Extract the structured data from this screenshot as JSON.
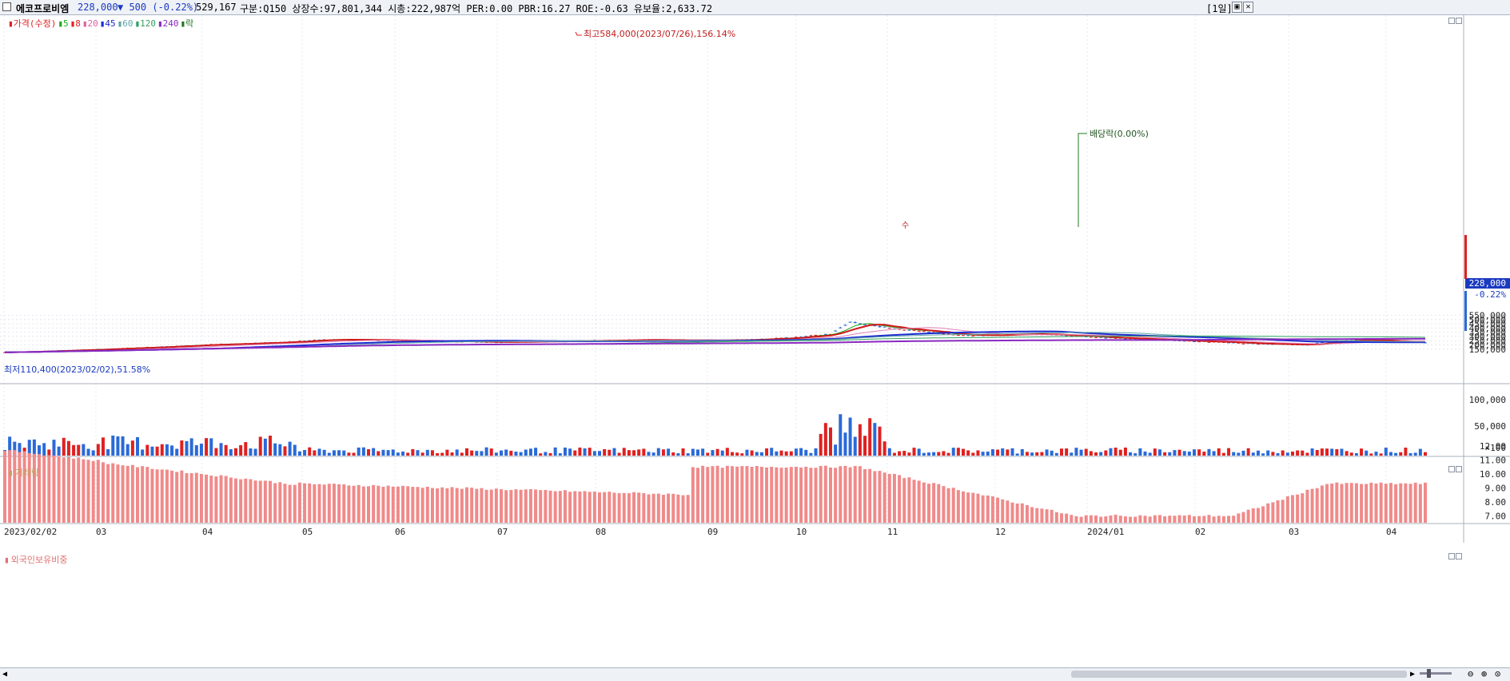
{
  "header": {
    "stock_name": "에코프로비엠",
    "price": "228,000",
    "change": "▼ 500 (-0.22%)",
    "volume": "529,167",
    "info": "구분:Q150 상장수:97,801,344 시총:222,987억 PER:0.00 PBR:16.27 ROE:-0.63 유보율:2,633.72",
    "period_button": "[1일]",
    "restore_icon": "restore-window-icon",
    "close_icon": "close-window-icon"
  },
  "price_panel": {
    "legend": [
      {
        "text": "가격(수정)",
        "color": "#e02020"
      },
      {
        "text": "5",
        "color": "#22aa22"
      },
      {
        "text": "8",
        "color": "#e02020"
      },
      {
        "text": "20",
        "color": "#e060a0"
      },
      {
        "text": "45",
        "color": "#1a2ad0"
      },
      {
        "text": "60",
        "color": "#60a8a8"
      },
      {
        "text": "120",
        "color": "#30a060"
      },
      {
        "text": "240",
        "color": "#8a2ac0"
      },
      {
        "text": "락",
        "color": "#227722"
      }
    ],
    "high_annotation": "최고584,000(2023/07/26),156.14%",
    "low_annotation": "최저110,400(2023/02/02),51.58%",
    "dividend_annotation": "배당락(0.00%)",
    "split_marker": "수",
    "y_ticks": [
      "550,000",
      "500,000",
      "450,000",
      "400,000",
      "350,000",
      "300,000",
      "250,000",
      "200,000",
      "150,000"
    ],
    "current_price_label": "228,000",
    "current_change_label": "-0.22%"
  },
  "volume_panel": {
    "title": "거래량",
    "y_ticks": [
      "100,000",
      "50,000",
      "×100"
    ]
  },
  "foreign_panel": {
    "title": "외국인보유비중",
    "y_ticks": [
      "12.00",
      "11.00",
      "10.00",
      "9.00",
      "8.00",
      "7.00"
    ]
  },
  "x_axis": {
    "labels": [
      "2023/02/02",
      "03",
      "04",
      "05",
      "06",
      "07",
      "08",
      "09",
      "10",
      "11",
      "12",
      "2024/01",
      "02",
      "03",
      "04"
    ]
  },
  "colors": {
    "up": "#e02020",
    "down": "#2a6ad8",
    "foreign_bar": "#f08a8a",
    "grid": "#e4e8ee"
  }
}
